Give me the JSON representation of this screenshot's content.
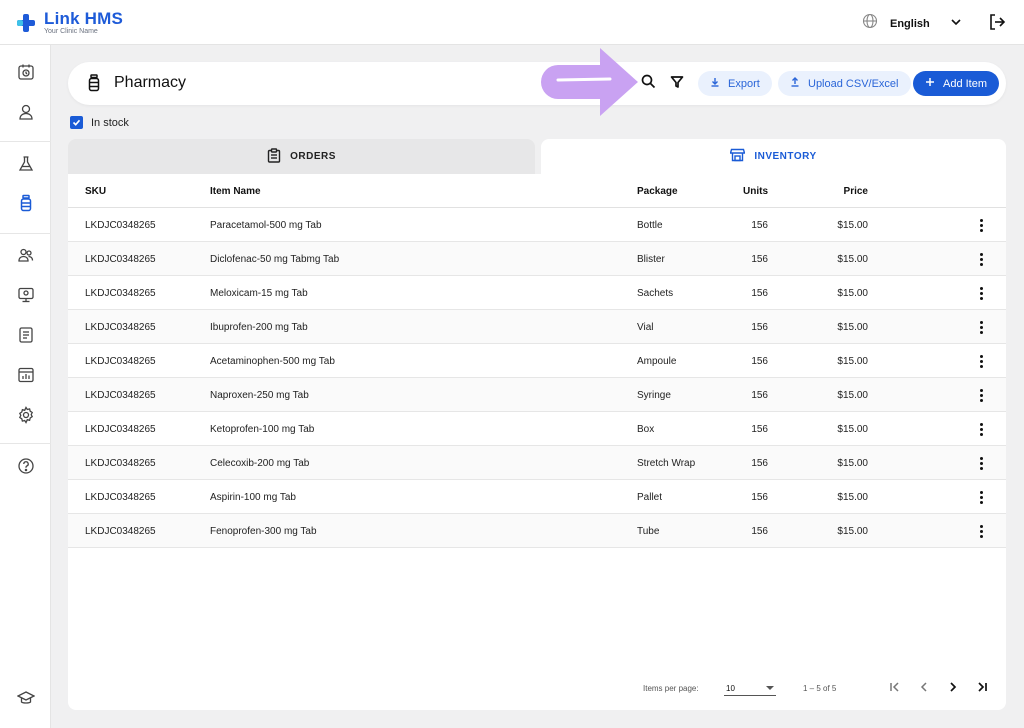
{
  "app": {
    "name": "Link HMS",
    "subtitle": "Your Clinic Name",
    "language": "English"
  },
  "header": {
    "title": "Pharmacy",
    "export_label": "Export",
    "upload_label": "Upload CSV/Excel",
    "add_label": "Add Item"
  },
  "filter": {
    "in_stock_label": "In stock",
    "in_stock_checked": true
  },
  "tabs": [
    {
      "label": "ORDERS",
      "active": false
    },
    {
      "label": "INVENTORY",
      "active": true
    }
  ],
  "table": {
    "columns": [
      "SKU",
      "Item Name",
      "Package",
      "Units",
      "Price"
    ],
    "rows": [
      {
        "sku": "LKDJC0348265",
        "name": "Paracetamol-500 mg Tab",
        "package": "Bottle",
        "units": "156",
        "price": "$15.00"
      },
      {
        "sku": "LKDJC0348265",
        "name": "Diclofenac-50 mg Tabmg Tab",
        "package": "Blister",
        "units": "156",
        "price": "$15.00"
      },
      {
        "sku": "LKDJC0348265",
        "name": "Meloxicam-15 mg Tab",
        "package": "Sachets",
        "units": "156",
        "price": "$15.00"
      },
      {
        "sku": "LKDJC0348265",
        "name": "Ibuprofen-200 mg Tab",
        "package": "Vial",
        "units": "156",
        "price": "$15.00"
      },
      {
        "sku": "LKDJC0348265",
        "name": "Acetaminophen-500 mg Tab",
        "package": "Ampoule",
        "units": "156",
        "price": "$15.00"
      },
      {
        "sku": "LKDJC0348265",
        "name": "Naproxen-250 mg Tab",
        "package": "Syringe",
        "units": "156",
        "price": "$15.00"
      },
      {
        "sku": "LKDJC0348265",
        "name": "Ketoprofen-100 mg Tab",
        "package": "Box",
        "units": "156",
        "price": "$15.00"
      },
      {
        "sku": "LKDJC0348265",
        "name": "Celecoxib-200 mg Tab",
        "package": "Stretch Wrap",
        "units": "156",
        "price": "$15.00"
      },
      {
        "sku": "LKDJC0348265",
        "name": "Aspirin-100 mg Tab",
        "package": "Pallet",
        "units": "156",
        "price": "$15.00"
      },
      {
        "sku": "LKDJC0348265",
        "name": "Fenoprofen-300 mg Tab",
        "package": "Tube",
        "units": "156",
        "price": "$15.00"
      }
    ]
  },
  "pagination": {
    "items_per_page_label": "Items per page:",
    "items_per_page": "10",
    "range": "1 – 5 of 5"
  },
  "colors": {
    "accent": "#1a5bd6",
    "accent_soft": "#eaf1fd",
    "highlight_arrow": "#c9a2f2"
  },
  "icons": {
    "sidebar": [
      "calendar-icon",
      "user-icon",
      "lab-flask-icon",
      "pharmacy-bottle-icon",
      "staff-icon",
      "monitor-icon",
      "report-icon",
      "analytics-icon",
      "settings-gear-icon",
      "help-icon",
      "education-cap-icon"
    ]
  }
}
